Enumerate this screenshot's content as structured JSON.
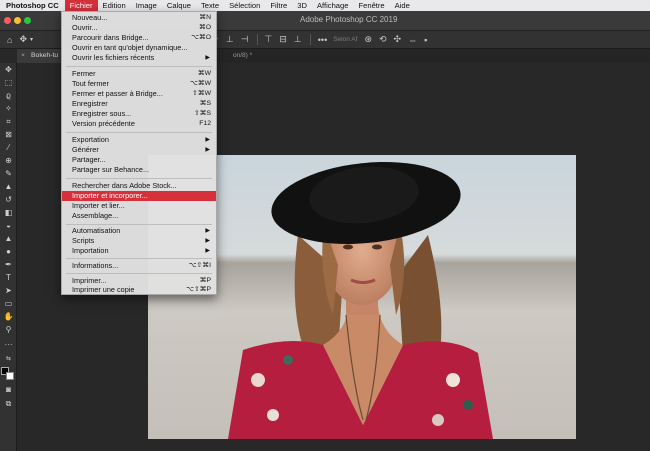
{
  "menubar": {
    "app": "Photoshop CC",
    "items": [
      "Fichier",
      "Edition",
      "Image",
      "Calque",
      "Texte",
      "Sélection",
      "Filtre",
      "3D",
      "Affichage",
      "Fenêtre",
      "Aide"
    ],
    "active": "Fichier"
  },
  "window": {
    "title": "Adobe Photoshop CC 2019"
  },
  "optionsbar": {
    "label": "Selon Af"
  },
  "tabs": [
    {
      "label": "Bokeh-tu"
    },
    {
      "label": "on/8) *"
    }
  ],
  "menu": {
    "items": [
      {
        "label": "Nouveau...",
        "shortcut": "⌘N"
      },
      {
        "label": "Ouvrir...",
        "shortcut": "⌘O"
      },
      {
        "label": "Parcourir dans Bridge...",
        "shortcut": "⌥⌘O"
      },
      {
        "label": "Ouvrir en tant qu'objet dynamique...",
        "shortcut": ""
      },
      {
        "label": "Ouvrir les fichiers récents",
        "shortcut": "▶"
      },
      {
        "label": "Fermer",
        "shortcut": "⌘W"
      },
      {
        "label": "Tout fermer",
        "shortcut": "⌥⌘W"
      },
      {
        "label": "Fermer et passer à Bridge...",
        "shortcut": "⇧⌘W"
      },
      {
        "label": "Enregistrer",
        "shortcut": "⌘S"
      },
      {
        "label": "Enregistrer sous...",
        "shortcut": "⇧⌘S"
      },
      {
        "label": "Version précédente",
        "shortcut": "F12"
      },
      {
        "label": "Exportation",
        "shortcut": "▶"
      },
      {
        "label": "Générer",
        "shortcut": "▶"
      },
      {
        "label": "Partager...",
        "shortcut": ""
      },
      {
        "label": "Partager sur Behance...",
        "shortcut": ""
      },
      {
        "label": "Rechercher dans Adobe Stock...",
        "shortcut": ""
      },
      {
        "label": "Importer et incorporer...",
        "shortcut": ""
      },
      {
        "label": "Importer et lier...",
        "shortcut": ""
      },
      {
        "label": "Assemblage...",
        "shortcut": ""
      },
      {
        "label": "Automatisation",
        "shortcut": "▶"
      },
      {
        "label": "Scripts",
        "shortcut": "▶"
      },
      {
        "label": "Importation",
        "shortcut": "▶"
      },
      {
        "label": "Informations...",
        "shortcut": "⌥⇧⌘I"
      },
      {
        "label": "Imprimer...",
        "shortcut": "⌘P"
      },
      {
        "label": "Imprimer une copie",
        "shortcut": "⌥⇧⌘P"
      }
    ],
    "highlighted": "Importer et incorporer..."
  },
  "colors": {
    "accent": "#d6303a",
    "menu_bg": "#e1e1e1",
    "app_bg": "#282828"
  },
  "icons": {
    "tools": [
      "move-icon",
      "marquee-icon",
      "lasso-icon",
      "magic-wand-icon",
      "crop-icon",
      "frame-icon",
      "eyedropper-icon",
      "healing-brush-icon",
      "brush-icon",
      "stamp-icon",
      "history-brush-icon",
      "eraser-icon",
      "paint-bucket-icon",
      "gradient-icon",
      "dodge-icon",
      "pen-icon",
      "type-icon",
      "path-select-icon",
      "shape-icon",
      "hand-icon",
      "zoom-icon",
      "more-tools-icon",
      "default-colors-icon",
      "color-swatches-icon",
      "quick-mask-icon",
      "screen-mode-icon"
    ]
  }
}
